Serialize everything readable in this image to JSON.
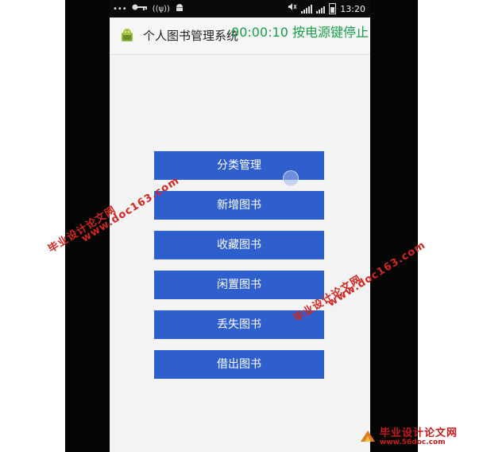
{
  "statusbar": {
    "left_icons": [
      "dots-icon",
      "key-icon",
      "wifi-icon",
      "android-debug-icon"
    ],
    "wifi_text": "((ψ))",
    "time": "13:20"
  },
  "actionbar": {
    "title": "个人图书管理系统",
    "recording_timer": "00:00:10",
    "recording_hint": "按电源键停止"
  },
  "menu": {
    "items": [
      {
        "label": "分类管理"
      },
      {
        "label": "新增图书"
      },
      {
        "label": "收藏图书"
      },
      {
        "label": "闲置图书"
      },
      {
        "label": "丢失图书"
      },
      {
        "label": "借出图书"
      }
    ]
  },
  "watermarks": {
    "site_name": "毕业设计论文网",
    "url": "www.doc163.com"
  },
  "footer": {
    "title": "毕业设计论文网",
    "url": "www.56doc.com"
  },
  "colors": {
    "button": "#2f5fcc",
    "recording": "#17a04a",
    "watermark": "#d2261f"
  }
}
